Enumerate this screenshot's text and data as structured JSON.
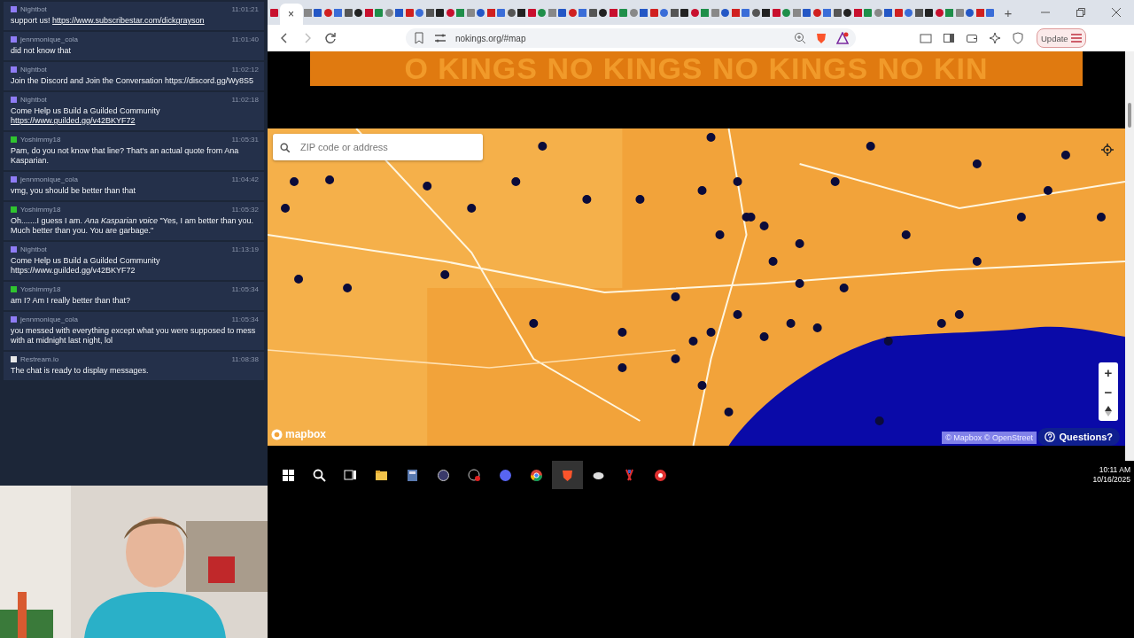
{
  "chat": {
    "messages": [
      {
        "user": "Nightbot",
        "color": "#8f7cf5",
        "time": "11:01:21",
        "text": "support us!",
        "link": "https://www.subscribestar.com/dickgrayson"
      },
      {
        "user": "jennmonique_cola",
        "color": "#8f7cf5",
        "time": "11:01:40",
        "text": "did not know that"
      },
      {
        "user": "Nightbot",
        "color": "#8f7cf5",
        "time": "11:02:12",
        "text": "Join the Discord and Join the Conversation https://discord.gg/Wy8S5"
      },
      {
        "user": "Nightbot",
        "color": "#8f7cf5",
        "time": "11:02:18",
        "text": "Come Help us Build a Guilded Community",
        "link": "https://www.guilded.gg/v42BKYF72"
      },
      {
        "user": "Yoshimmy18",
        "color": "#2fc42f",
        "time": "11:05:31",
        "text": "Pam, do you not know that line? That's an actual quote from Ana Kasparian."
      },
      {
        "user": "jennmonique_cola",
        "color": "#8f7cf5",
        "time": "11:04:42",
        "text": "vmg, you should be better than that"
      },
      {
        "user": "Yoshimmy18",
        "color": "#2fc42f",
        "time": "11:05:32",
        "text": "Oh.......I guess I am. *Ana Kasparian voice* \"Yes, I am better than you. Much better than you. You are garbage.\""
      },
      {
        "user": "Nightbot",
        "color": "#8f7cf5",
        "time": "11:13:19",
        "text": "Come Help us Build a Guilded Community https://www.guilded.gg/v42BKYF72"
      },
      {
        "user": "Yoshimmy18",
        "color": "#2fc42f",
        "time": "11:05:34",
        "text": "am I? Am I really better than that?"
      },
      {
        "user": "jennmonique_cola",
        "color": "#8f7cf5",
        "time": "11:05:34",
        "text": "you messed with everything except what you were supposed to mess with at midnight last night, lol"
      },
      {
        "user": "Restream.io",
        "color": "#e8e8e8",
        "time": "11:08:38",
        "text": "The chat is ready to display messages."
      }
    ]
  },
  "browser": {
    "tabs": [
      {
        "selected": false
      },
      {
        "selected": true,
        "close": "×"
      },
      {
        "selected": false
      },
      {
        "selected": false
      },
      {
        "selected": false
      },
      {
        "selected": false
      },
      {
        "selected": false
      },
      {
        "selected": false
      },
      {
        "selected": false
      },
      {
        "selected": false
      },
      {
        "selected": false
      },
      {
        "selected": false
      },
      {
        "selected": false
      },
      {
        "selected": false
      },
      {
        "selected": false
      },
      {
        "selected": false
      },
      {
        "selected": false
      },
      {
        "selected": false
      },
      {
        "selected": false
      },
      {
        "selected": false
      },
      {
        "selected": false
      },
      {
        "selected": false
      },
      {
        "selected": false
      },
      {
        "selected": false
      },
      {
        "selected": false
      },
      {
        "selected": false
      },
      {
        "selected": false
      },
      {
        "selected": false
      },
      {
        "selected": false
      },
      {
        "selected": false
      },
      {
        "selected": false
      },
      {
        "selected": false
      },
      {
        "selected": false
      },
      {
        "selected": false
      },
      {
        "selected": false
      },
      {
        "selected": false
      },
      {
        "selected": false
      },
      {
        "selected": false
      },
      {
        "selected": false
      },
      {
        "selected": false
      },
      {
        "selected": false
      },
      {
        "selected": false
      },
      {
        "selected": false
      },
      {
        "selected": false
      },
      {
        "selected": false
      },
      {
        "selected": false
      },
      {
        "selected": false
      },
      {
        "selected": false
      },
      {
        "selected": false
      },
      {
        "selected": false
      },
      {
        "selected": false
      },
      {
        "selected": false
      },
      {
        "selected": false
      },
      {
        "selected": false
      },
      {
        "selected": false
      },
      {
        "selected": false
      },
      {
        "selected": false
      },
      {
        "selected": false
      },
      {
        "selected": false
      },
      {
        "selected": false
      },
      {
        "selected": false
      },
      {
        "selected": false
      },
      {
        "selected": false
      },
      {
        "selected": false
      },
      {
        "selected": false
      },
      {
        "selected": false
      },
      {
        "selected": false
      },
      {
        "selected": false
      },
      {
        "selected": false
      },
      {
        "selected": false
      }
    ],
    "new_tab": "+",
    "address": "nokings.org/#map",
    "update_button": "Update"
  },
  "page": {
    "banner": "O KINGS NO KINGS NO KINGS NO KIN",
    "map": {
      "kind": "picture",
      "search": {
        "placeholder": "ZIP code or address"
      },
      "zoom_in": "+",
      "zoom_out": "−",
      "logo": "mapbox",
      "attribution": "© Mapbox © OpenStreet",
      "questions_button": "Questions?"
    }
  },
  "taskbar": {
    "time": "10:11 AM",
    "date": "10/16/2025"
  }
}
